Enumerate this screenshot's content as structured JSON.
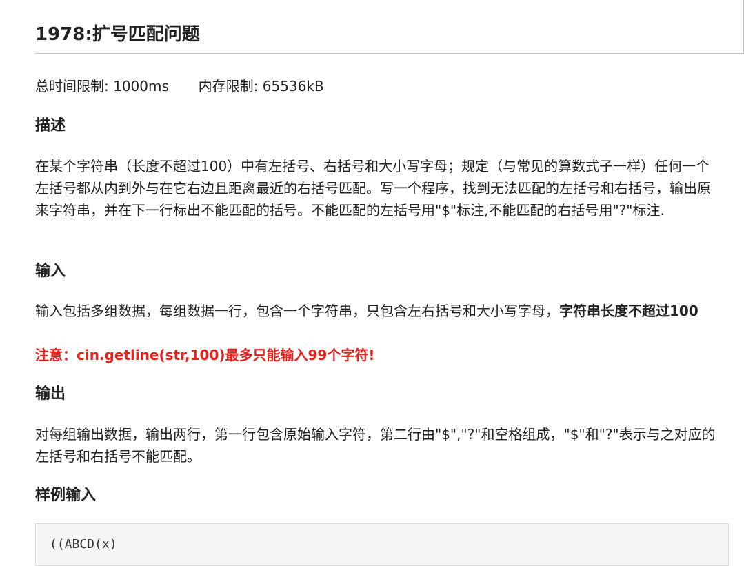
{
  "problem": {
    "title": "1978:扩号匹配问题",
    "time_limit_label": "总时间限制:",
    "time_limit_value": "1000ms",
    "memory_limit_label": "内存限制:",
    "memory_limit_value": "65536kB"
  },
  "description": {
    "heading": "描述",
    "text": "在某个字符串（长度不超过100）中有左括号、右括号和大小写字母；规定（与常见的算数式子一样）任何一个左括号都从内到外与在它右边且距离最近的右括号匹配。写一个程序，找到无法匹配的左括号和右括号，输出原来字符串，并在下一行标出不能匹配的括号。不能匹配的左括号用\"$\"标注,不能匹配的右括号用\"?\"标注."
  },
  "input": {
    "heading": "输入",
    "text_plain": "输入包括多组数据，每组数据一行，包含一个字符串，只包含左右括号和大小写字母，",
    "text_bold": "字符串长度不超过100",
    "warning": "注意：cin.getline(str,100)最多只能输入99个字符!"
  },
  "output": {
    "heading": "输出",
    "text": "对每组输出数据，输出两行，第一行包含原始输入字符，第二行由\"$\",\"?\"和空格组成，\"$\"和\"?\"表示与之对应的左括号和右括号不能匹配。"
  },
  "sample_input": {
    "heading": "样例输入",
    "code": "((ABCD(x)"
  }
}
